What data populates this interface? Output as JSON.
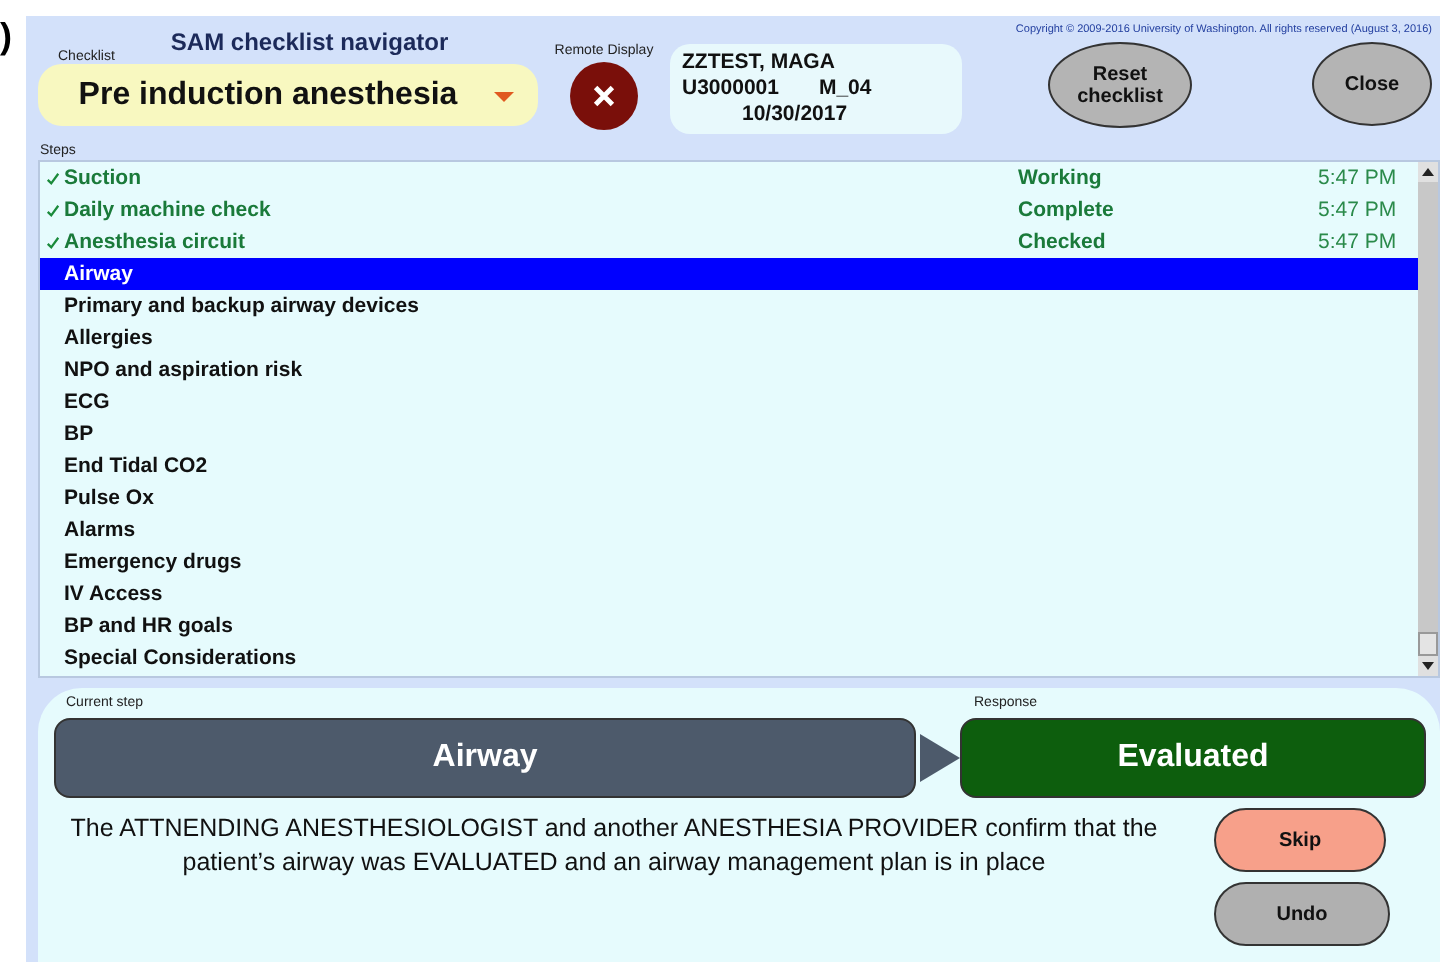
{
  "figure_label": ")",
  "header": {
    "title": "SAM checklist navigator",
    "checklist_label": "Checklist",
    "checklist": "Pre induction anesthesia",
    "remote_label": "Remote Display",
    "remote_on": false,
    "patient": [
      "ZZTEST, MAGA",
      "U3000001",
      "M_04",
      "10/30/2017"
    ],
    "copyright": "Copyright © 2009-2016 University of Washington. All rights reserved  (August 3, 2016)",
    "buttons": [
      "Reset checklist",
      "Close"
    ]
  },
  "steps_label": "Steps",
  "steps": [
    {
      "name": "Suction",
      "done": true,
      "selected": false,
      "status": "Working",
      "time": "5:47 PM"
    },
    {
      "name": "Daily machine check",
      "done": true,
      "selected": false,
      "status": "Complete",
      "time": "5:47 PM"
    },
    {
      "name": "Anesthesia circuit",
      "done": true,
      "selected": false,
      "status": "Checked",
      "time": "5:47 PM"
    },
    {
      "name": "Airway",
      "done": false,
      "selected": true
    },
    {
      "name": "Primary and backup airway devices",
      "done": false,
      "selected": false
    },
    {
      "name": "Allergies",
      "done": false,
      "selected": false
    },
    {
      "name": "NPO and aspiration risk",
      "done": false,
      "selected": false
    },
    {
      "name": "ECG",
      "done": false,
      "selected": false
    },
    {
      "name": "BP",
      "done": false,
      "selected": false
    },
    {
      "name": "End Tidal CO2",
      "done": false,
      "selected": false
    },
    {
      "name": "Pulse Ox",
      "done": false,
      "selected": false
    },
    {
      "name": "Alarms",
      "done": false,
      "selected": false
    },
    {
      "name": "Emergency drugs",
      "done": false,
      "selected": false
    },
    {
      "name": "IV Access",
      "done": false,
      "selected": false
    },
    {
      "name": "BP and HR goals",
      "done": false,
      "selected": false
    },
    {
      "name": "Special Considerations",
      "done": false,
      "selected": false
    }
  ],
  "current": {
    "step_label": "Current step",
    "step": "Airway",
    "response_label": "Response",
    "response": "Evaluated",
    "description": "The ATTNENDING ANESTHESIOLOGIST and another ANESTHESIA PROVIDER confirm that the patient’s airway was EVALUATED and an airway management plan is in place",
    "buttons": [
      {
        "label": "Skip",
        "kind": "skip"
      },
      {
        "label": "Undo",
        "kind": "undo"
      }
    ]
  }
}
